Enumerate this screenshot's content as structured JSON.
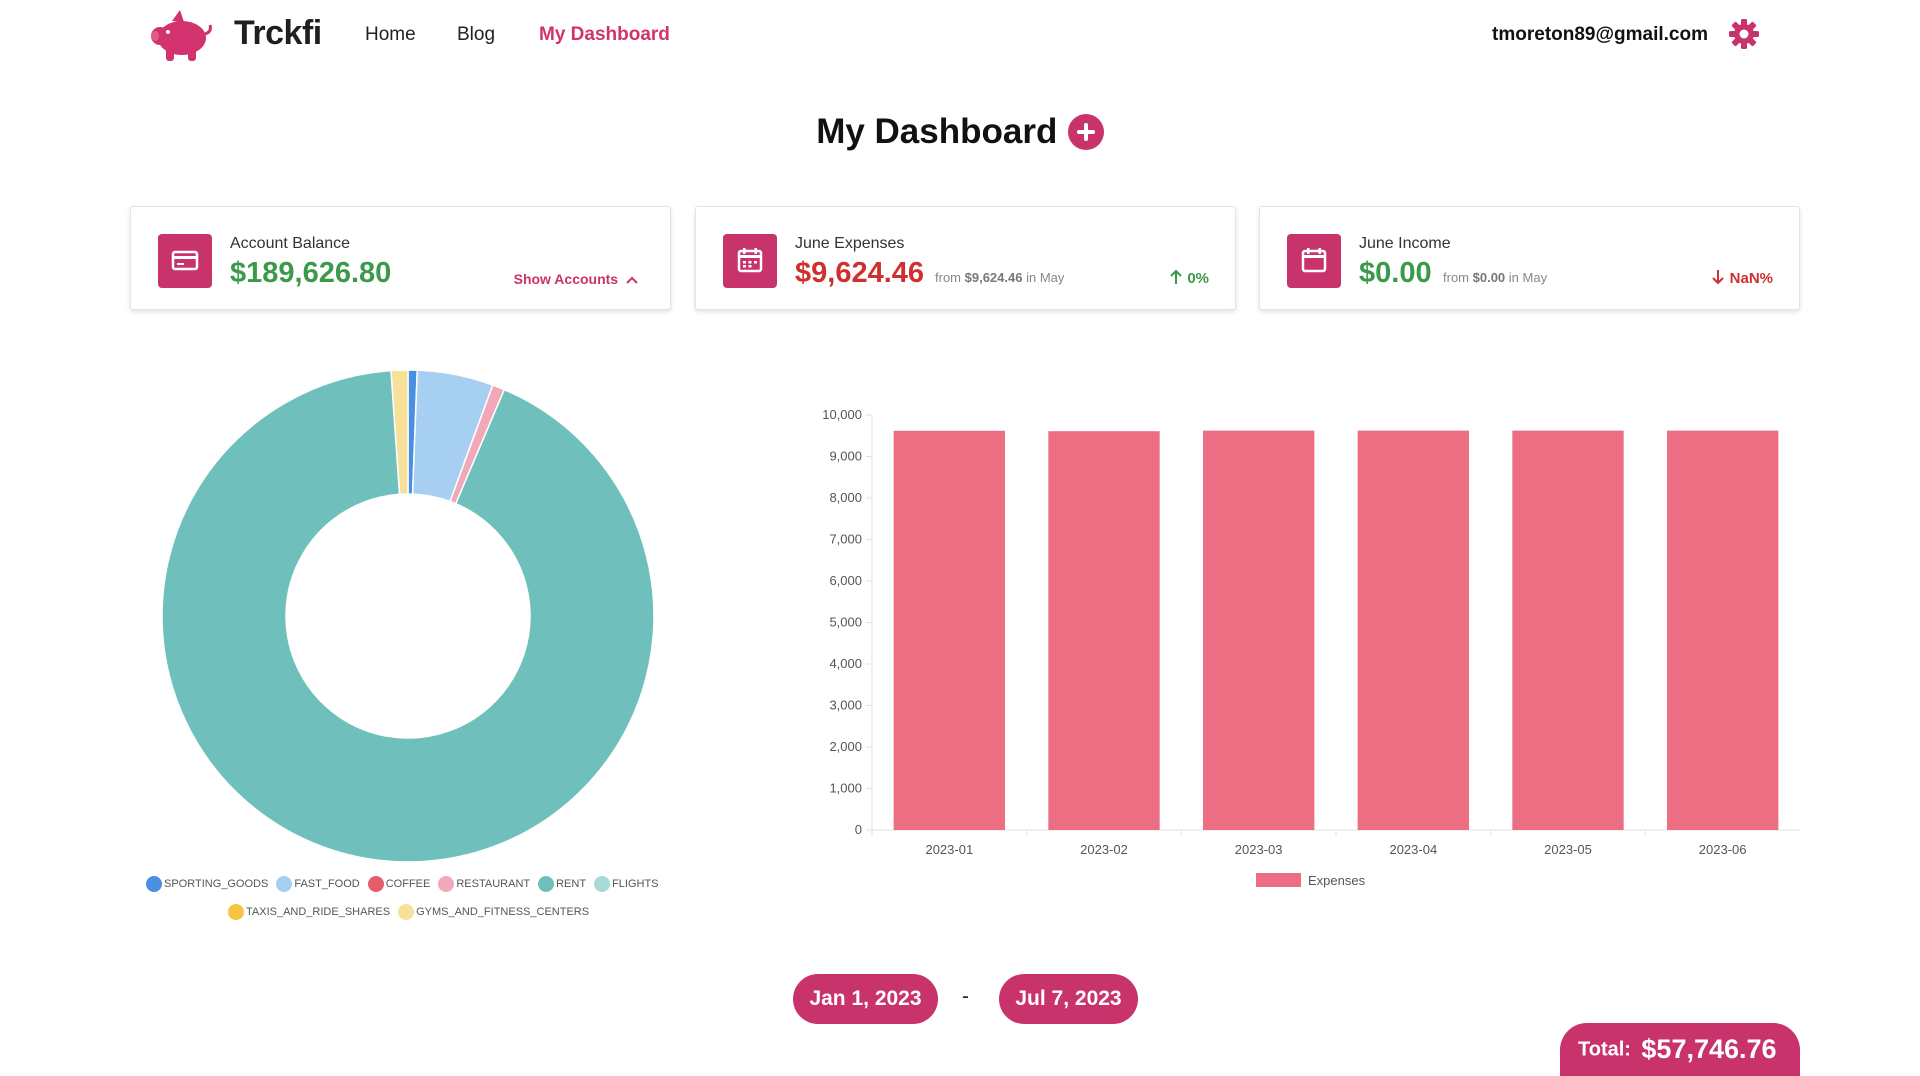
{
  "header": {
    "brand": "Trckfi",
    "nav": {
      "home": "Home",
      "blog": "Blog",
      "dashboard": "My Dashboard"
    },
    "user_email": "tmoreton89@gmail.com",
    "icons": {
      "logo": "piggy-bank-icon",
      "settings": "gear-icon"
    }
  },
  "page": {
    "title": "My Dashboard"
  },
  "colors": {
    "accent": "#c9336c",
    "positive": "#3a9a4a",
    "negative": "#cf2f2f"
  },
  "cards": [
    {
      "label": "Account Balance",
      "value": "$189,626.80",
      "action": "Show Accounts",
      "icon": "credit-card-icon"
    },
    {
      "label": "June Expenses",
      "value": "$9,624.46",
      "from_prefix": "from",
      "from_value": "$9,624.46",
      "from_suffix": "in May",
      "trend": "0%",
      "trend_direction": "up",
      "icon": "calendar-icon"
    },
    {
      "label": "June Income",
      "value": "$0.00",
      "from_prefix": "from",
      "from_value": "$0.00",
      "from_suffix": "in May",
      "trend": "NaN%",
      "trend_direction": "down",
      "icon": "calendar-icon"
    }
  ],
  "chart_data": [
    {
      "type": "pie",
      "subtype": "donut",
      "categories": [
        "SPORTING_GOODS",
        "FAST_FOOD",
        "COFFEE",
        "RESTAURANT",
        "RENT",
        "FLIGHTS",
        "TAXIS_AND_RIDE_SHARES",
        "GYMS_AND_FITNESS_CENTERS"
      ],
      "values": [
        0.6,
        5.0,
        0.0,
        0.8,
        92.5,
        0.0,
        0.0,
        1.1
      ],
      "colors": [
        "#4a90e2",
        "#a6cff2",
        "#e35d6a",
        "#f2a8b8",
        "#6fbfbd",
        "#a8dada",
        "#f5c542",
        "#f7e09a"
      ],
      "legend_position": "bottom"
    },
    {
      "type": "bar",
      "categories": [
        "2023-01",
        "2023-02",
        "2023-03",
        "2023-04",
        "2023-05",
        "2023-06"
      ],
      "series": [
        {
          "name": "Expenses",
          "values": [
            9620,
            9610,
            9624,
            9624,
            9624,
            9624
          ]
        }
      ],
      "ylim": [
        0,
        10000
      ],
      "yticks": [
        "0",
        "1,000",
        "2,000",
        "3,000",
        "4,000",
        "5,000",
        "6,000",
        "7,000",
        "8,000",
        "9,000",
        "10,000"
      ],
      "color": "#eb6e83",
      "grid": false,
      "legend_position": "bottom"
    }
  ],
  "date_range": {
    "start": "Jan 1, 2023",
    "separator": "-",
    "end": "Jul 7, 2023"
  },
  "total": {
    "label": "Total:",
    "value": "$57,746.76"
  }
}
